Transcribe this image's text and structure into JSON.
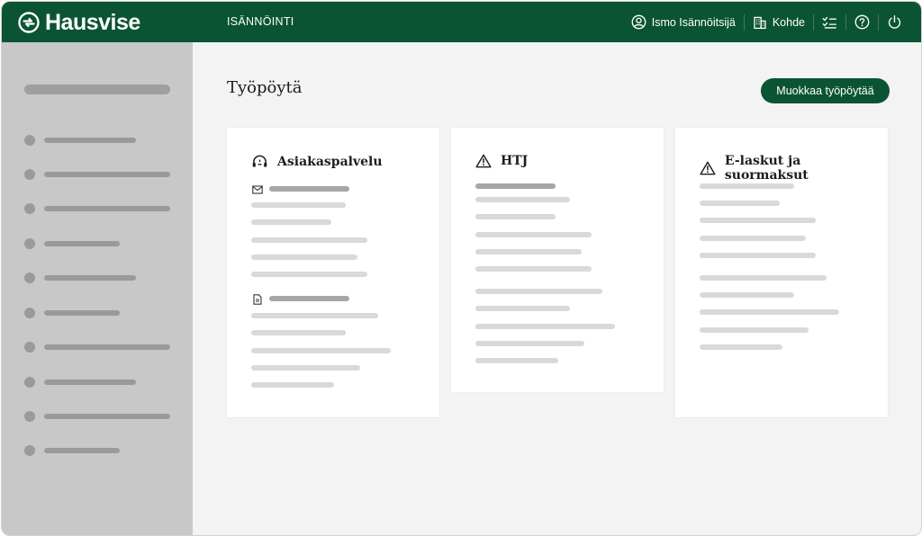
{
  "app": {
    "brand": "Hausvise",
    "section": "ISÄNNÖINTI"
  },
  "topnav": {
    "user": "Ismo Isännöitsijä",
    "property": "Kohde",
    "icons": [
      "user-circle-icon",
      "building-icon",
      "checklist-icon",
      "help-icon",
      "power-icon"
    ]
  },
  "page": {
    "title": "Työpöytä",
    "edit_button": "Muokkaa työpöytää"
  },
  "cards": [
    {
      "title": "Asiakaspalvelu",
      "icon": "headset-icon"
    },
    {
      "title": "HTJ",
      "icon": "warning-icon"
    },
    {
      "title": "E-laskut ja suormaksut",
      "icon": "warning-icon"
    }
  ],
  "colors": {
    "brand_green": "#0b5433",
    "sidebar_bg": "#c8c8c8",
    "main_bg": "#f2f3f2"
  }
}
